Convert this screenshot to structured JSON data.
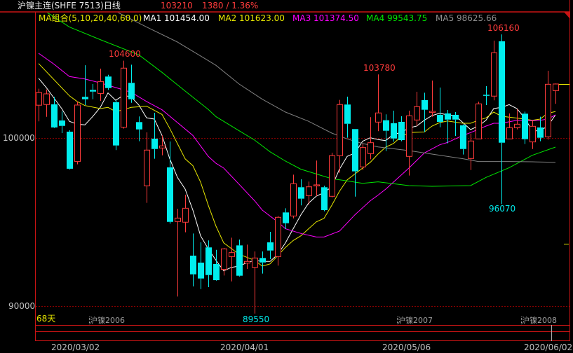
{
  "header": {
    "title": "沪镍主连(SHFE 7513)日线",
    "last_price": "103210",
    "change": "1380 / 1.36%"
  },
  "ma_legend": {
    "group": "MA组合(5,10,20,40,60,0)",
    "ma1": "MA1 101454.00",
    "ma2": "MA2 101623.00",
    "ma3": "MA3 101374.50",
    "ma4": "MA4 99543.75",
    "ma5": "MA5 98625.66"
  },
  "footer": {
    "days": "68天",
    "contracts": [
      "沪镍2006",
      "沪镍2007",
      "沪镍2008"
    ],
    "dates": [
      "2020/03/02",
      "2020/04/01",
      "2020/05/06",
      "2020/06/02"
    ]
  },
  "colors": {
    "up": "#ff3b3b",
    "down": "#00eeee",
    "ma1": "#ffffff",
    "ma2": "#e6e600",
    "ma3": "#ff00ff",
    "ma4": "#00e600",
    "ma5": "#808080",
    "frame": "#c81414",
    "grid": "#8a0000"
  },
  "chart_data": {
    "type": "candlestick",
    "title": "沪镍主连(SHFE 7513)日线",
    "y_ticks": [
      "100000",
      "90000"
    ],
    "y_tick_values": [
      100000,
      90000
    ],
    "annotations": [
      {
        "text": "104600",
        "index": 11,
        "kind": "high"
      },
      {
        "text": "103780",
        "index": 44,
        "kind": "high"
      },
      {
        "text": "106160",
        "index": 60,
        "kind": "high"
      },
      {
        "text": "96070",
        "index": 60,
        "kind": "low"
      },
      {
        "text": "89550",
        "index": 28,
        "kind": "low"
      }
    ],
    "ohlc": [
      [
        101950,
        102930,
        100990,
        102700
      ],
      [
        101990,
        102890,
        101260,
        102625
      ],
      [
        102000,
        102445,
        100600,
        100625
      ],
      [
        101040,
        101580,
        100290,
        100720
      ],
      [
        100375,
        100460,
        98125,
        98170
      ],
      [
        98600,
        102170,
        98430,
        101960
      ],
      [
        102445,
        104330,
        101960,
        102305
      ],
      [
        102860,
        103210,
        102305,
        102760
      ],
      [
        102650,
        104125,
        102210,
        103360
      ],
      [
        103655,
        103760,
        102860,
        102970
      ],
      [
        102125,
        102240,
        99280,
        99555
      ],
      [
        100640,
        104600,
        100555,
        104155
      ],
      [
        103280,
        104360,
        102095,
        102305
      ],
      [
        100945,
        101280,
        99805,
        100510
      ],
      [
        97155,
        100335,
        96140,
        99280
      ],
      [
        99960,
        101500,
        98765,
        99345
      ],
      [
        99405,
        100150,
        98970,
        99530
      ],
      [
        98250,
        99790,
        94900,
        95010
      ],
      [
        95030,
        95790,
        90570,
        95235
      ],
      [
        94990,
        96625,
        94390,
        95820
      ],
      [
        93000,
        94320,
        91170,
        91890
      ],
      [
        92585,
        93790,
        91010,
        91640
      ],
      [
        93490,
        93905,
        91125,
        91845
      ],
      [
        92500,
        93345,
        91510,
        91540
      ],
      [
        92180,
        93460,
        91820,
        93405
      ],
      [
        92945,
        94070,
        91470,
        93180
      ],
      [
        93610,
        93960,
        91760,
        91805
      ],
      [
        92555,
        93655,
        92210,
        92655
      ],
      [
        92305,
        93250,
        89550,
        92860
      ],
      [
        92860,
        93250,
        91930,
        92595
      ],
      [
        93790,
        94415,
        92790,
        93305
      ],
      [
        92945,
        95360,
        92405,
        95280
      ],
      [
        95570,
        95820,
        94595,
        94930
      ],
      [
        95360,
        97820,
        95220,
        97280
      ],
      [
        97070,
        97540,
        95990,
        96390
      ],
      [
        96570,
        97405,
        96030,
        97095
      ],
      [
        97155,
        98655,
        96540,
        97210
      ],
      [
        97070,
        97155,
        95640,
        95710
      ],
      [
        96530,
        99125,
        96470,
        98945
      ],
      [
        98945,
        102265,
        97930,
        101990
      ],
      [
        101990,
        102460,
        100015,
        100845
      ],
      [
        100530,
        100530,
        96510,
        98015
      ],
      [
        98280,
        99640,
        98095,
        99430
      ],
      [
        99070,
        101240,
        98735,
        99720
      ],
      [
        100945,
        103780,
        100405,
        101490
      ],
      [
        101055,
        101405,
        99220,
        100430
      ],
      [
        100875,
        101625,
        99780,
        99970
      ],
      [
        100960,
        101290,
        99805,
        99875
      ],
      [
        98905,
        101625,
        97765,
        101320
      ],
      [
        101070,
        102750,
        100710,
        101860
      ],
      [
        102250,
        102695,
        100360,
        101680
      ],
      [
        101515,
        103415,
        101265,
        101585
      ],
      [
        101375,
        103000,
        100640,
        100960
      ],
      [
        101460,
        101665,
        99680,
        101095
      ],
      [
        101375,
        101540,
        100125,
        101095
      ],
      [
        100750,
        100810,
        99015,
        99345
      ],
      [
        98780,
        100265,
        98095,
        99820
      ],
      [
        99945,
        102155,
        99945,
        102030
      ],
      [
        102570,
        103085,
        101960,
        102515
      ],
      [
        102490,
        105790,
        102240,
        105070
      ],
      [
        105750,
        106160,
        96070,
        99720
      ],
      [
        99945,
        101460,
        99945,
        100610
      ],
      [
        100610,
        101720,
        100510,
        100820
      ],
      [
        101445,
        101570,
        99640,
        99930
      ],
      [
        99765,
        101030,
        99345,
        100695
      ],
      [
        100625,
        101265,
        99805,
        100015
      ],
      [
        100070,
        104000,
        99905,
        103195
      ],
      [
        102820,
        103240,
        102030,
        103210
      ]
    ],
    "ma_series": [
      {
        "name": "MA1",
        "period": 5,
        "points": [
          [
            0,
            103555
          ],
          [
            1,
            103000
          ],
          [
            2,
            102375
          ],
          [
            3,
            101750
          ],
          [
            4,
            100990
          ],
          [
            5,
            100820
          ],
          [
            6,
            100780
          ],
          [
            7,
            101265
          ],
          [
            8,
            101820
          ],
          [
            9,
            102680
          ],
          [
            10,
            102240
          ],
          [
            11,
            102540
          ],
          [
            12,
            102445
          ],
          [
            13,
            101960
          ],
          [
            14,
            101195
          ],
          [
            15,
            101125
          ],
          [
            16,
            100150
          ],
          [
            17,
            98765
          ],
          [
            18,
            97655
          ],
          [
            19,
            96960
          ],
          [
            20,
            95710
          ],
          [
            21,
            94180
          ],
          [
            22,
            93400
          ],
          [
            23,
            92720
          ],
          [
            24,
            92095
          ],
          [
            25,
            92305
          ],
          [
            26,
            92375
          ],
          [
            27,
            92585
          ],
          [
            28,
            92720
          ],
          [
            29,
            92655
          ],
          [
            30,
            92655
          ],
          [
            31,
            93070
          ],
          [
            32,
            93760
          ],
          [
            33,
            94600
          ],
          [
            34,
            95430
          ],
          [
            35,
            96125
          ],
          [
            36,
            96540
          ],
          [
            37,
            96750
          ],
          [
            38,
            97095
          ],
          [
            39,
            98140
          ],
          [
            40,
            98905
          ],
          [
            41,
            99110
          ],
          [
            42,
            99805
          ],
          [
            43,
            100015
          ],
          [
            44,
            99905
          ],
          [
            45,
            99840
          ],
          [
            46,
            100220
          ],
          [
            47,
            100320
          ],
          [
            48,
            100595
          ],
          [
            49,
            100710
          ],
          [
            50,
            101055
          ],
          [
            51,
            101335
          ],
          [
            52,
            101470
          ],
          [
            53,
            101375
          ],
          [
            54,
            101335
          ],
          [
            55,
            100915
          ],
          [
            56,
            100500
          ],
          [
            57,
            100710
          ],
          [
            58,
            101055
          ],
          [
            59,
            101750
          ],
          [
            60,
            101820
          ],
          [
            61,
            101985
          ],
          [
            62,
            101750
          ],
          [
            63,
            101195
          ],
          [
            64,
            100430
          ],
          [
            65,
            100430
          ],
          [
            66,
            100710
          ],
          [
            67,
            101375
          ]
        ]
      },
      {
        "name": "MA2",
        "period": 10,
        "points": [
          [
            0,
            104430
          ],
          [
            4,
            102510
          ],
          [
            5,
            102170
          ],
          [
            6,
            101930
          ],
          [
            8,
            101750
          ],
          [
            9,
            101820
          ],
          [
            10,
            101570
          ],
          [
            11,
            101680
          ],
          [
            12,
            101820
          ],
          [
            14,
            101890
          ],
          [
            16,
            101400
          ],
          [
            17,
            100570
          ],
          [
            19,
            98760
          ],
          [
            20,
            98350
          ],
          [
            21,
            97375
          ],
          [
            22,
            95990
          ],
          [
            23,
            94750
          ],
          [
            24,
            93760
          ],
          [
            26,
            93080
          ],
          [
            28,
            92720
          ],
          [
            29,
            92375
          ],
          [
            30,
            92510
          ],
          [
            32,
            93490
          ],
          [
            33,
            93900
          ],
          [
            34,
            94180
          ],
          [
            35,
            94600
          ],
          [
            36,
            95010
          ],
          [
            37,
            95220
          ],
          [
            38,
            95990
          ],
          [
            39,
            96830
          ],
          [
            40,
            97510
          ],
          [
            41,
            97860
          ],
          [
            42,
            98210
          ],
          [
            43,
            98555
          ],
          [
            44,
            99040
          ],
          [
            45,
            99460
          ],
          [
            46,
            99670
          ],
          [
            47,
            100085
          ],
          [
            48,
            100320
          ],
          [
            50,
            100360
          ],
          [
            51,
            100710
          ],
          [
            52,
            100915
          ],
          [
            53,
            101010
          ],
          [
            55,
            100875
          ],
          [
            56,
            100875
          ],
          [
            57,
            101055
          ],
          [
            58,
            101195
          ],
          [
            59,
            101540
          ],
          [
            60,
            101290
          ],
          [
            61,
            101240
          ],
          [
            63,
            101125
          ],
          [
            64,
            101055
          ],
          [
            65,
            101125
          ],
          [
            66,
            101470
          ],
          [
            67,
            101570
          ]
        ]
      },
      {
        "name": "MA3",
        "period": 20,
        "points": [
          [
            0,
            105040
          ],
          [
            2,
            104390
          ],
          [
            4,
            103655
          ],
          [
            6,
            103510
          ],
          [
            8,
            103280
          ],
          [
            10,
            103000
          ],
          [
            12,
            102720
          ],
          [
            14,
            102170
          ],
          [
            16,
            101680
          ],
          [
            18,
            100915
          ],
          [
            20,
            100150
          ],
          [
            22,
            98905
          ],
          [
            23,
            98490
          ],
          [
            24,
            98210
          ],
          [
            26,
            97240
          ],
          [
            28,
            96265
          ],
          [
            29,
            95710
          ],
          [
            31,
            95010
          ],
          [
            32,
            94600
          ],
          [
            34,
            94320
          ],
          [
            36,
            94110
          ],
          [
            37,
            94110
          ],
          [
            39,
            94460
          ],
          [
            41,
            95430
          ],
          [
            43,
            96265
          ],
          [
            44,
            96600
          ],
          [
            45,
            96960
          ],
          [
            46,
            97375
          ],
          [
            48,
            98210
          ],
          [
            50,
            99110
          ],
          [
            52,
            99595
          ],
          [
            53,
            99735
          ],
          [
            55,
            100150
          ],
          [
            56,
            100320
          ],
          [
            58,
            100710
          ],
          [
            59,
            100875
          ],
          [
            60,
            100875
          ],
          [
            62,
            101055
          ],
          [
            64,
            101030
          ],
          [
            65,
            101055
          ],
          [
            66,
            101125
          ],
          [
            67,
            101375
          ]
        ]
      },
      {
        "name": "MA4",
        "period": 40,
        "points": [
          [
            0,
            107800
          ],
          [
            4,
            106600
          ],
          [
            8,
            105850
          ],
          [
            13,
            104945
          ],
          [
            16,
            103905
          ],
          [
            19,
            102790
          ],
          [
            22,
            101700
          ],
          [
            23,
            101265
          ],
          [
            26,
            100430
          ],
          [
            28,
            99875
          ],
          [
            30,
            99180
          ],
          [
            32,
            98625
          ],
          [
            34,
            98140
          ],
          [
            36,
            97860
          ],
          [
            38,
            97580
          ],
          [
            40,
            97445
          ],
          [
            42,
            97305
          ],
          [
            44,
            97390
          ],
          [
            48,
            97165
          ],
          [
            51,
            97125
          ],
          [
            56,
            97165
          ],
          [
            58,
            97655
          ],
          [
            61,
            98235
          ],
          [
            64,
            98970
          ],
          [
            67,
            99460
          ]
        ]
      },
      {
        "name": "MA5",
        "period": 60,
        "points": [
          [
            8,
            108000
          ],
          [
            14,
            106600
          ],
          [
            18,
            105710
          ],
          [
            22,
            104600
          ],
          [
            23,
            104320
          ],
          [
            26,
            103210
          ],
          [
            29,
            102305
          ],
          [
            32,
            101540
          ],
          [
            35,
            100990
          ],
          [
            38,
            100290
          ],
          [
            40,
            99945
          ],
          [
            42,
            99670
          ],
          [
            44,
            99470
          ],
          [
            48,
            99250
          ],
          [
            51,
            99040
          ],
          [
            55,
            98765
          ],
          [
            57,
            98600
          ],
          [
            61,
            98600
          ],
          [
            64,
            98585
          ],
          [
            67,
            98555
          ]
        ]
      }
    ]
  }
}
